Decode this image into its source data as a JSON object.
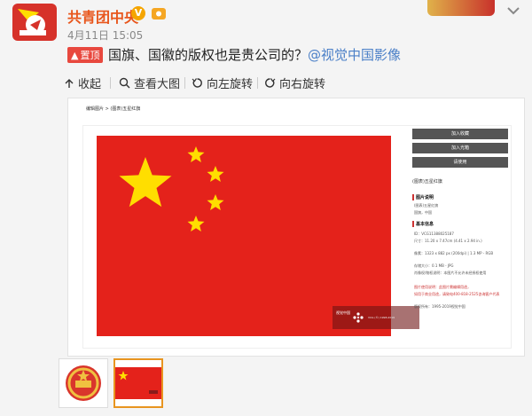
{
  "post": {
    "author": "共青团中央",
    "verified_mark": "V",
    "time": "4月11日 15:05",
    "pin_label": "置顶",
    "text": "国旗、国徽的版权也是贵公司的？",
    "mention": "@视觉中国影像"
  },
  "toolbar": {
    "collapse": "收起",
    "view_large": "查看大图",
    "rotate_left": "向左旋转",
    "rotate_right": "向右旋转"
  },
  "preview": {
    "breadcrumb": "编辑图片 > (图表)五星红旗",
    "watermark_brand": "视觉中国",
    "watermark_code": "VCG (©) 1998-2019",
    "sidebar": {
      "buttons": [
        "加入收藏",
        "加入光箱",
        "请使用"
      ],
      "item_title": "(图表)五星红旗",
      "section1_heading": "图片说明",
      "section1_lines": [
        "(图表)五星红旗",
        "国旗，中国"
      ],
      "section2_heading": "基本信息",
      "info_lines": [
        "ID：VCG11388025187",
        "尺寸：11.20 x 7.47cm (4.41 x 2.94 in.)",
        "像素：1323 x 882 px (200dpi) | 1.3 MP - RGB",
        "存储大小：0.1 MB - JPG",
        "肖像权/物权说明：本图片不允许未经授权使用"
      ],
      "red_lines": [
        "图片使用说明：此图片需编辑用途，",
        "如用于商业用途，请致电400-818-2525咨询客户代表"
      ],
      "copyright_line": "版权所有：1995-2019视觉中国"
    }
  },
  "colors": {
    "flag_red": "#e4221b",
    "star_yellow": "#ffde00",
    "author_orange": "#e8561c",
    "mention_blue": "#4a7fc7",
    "pin_red": "#e8483e"
  },
  "icons": [
    "collapse-icon",
    "search-icon",
    "rotate-left-icon",
    "rotate-right-icon",
    "more-icon"
  ]
}
